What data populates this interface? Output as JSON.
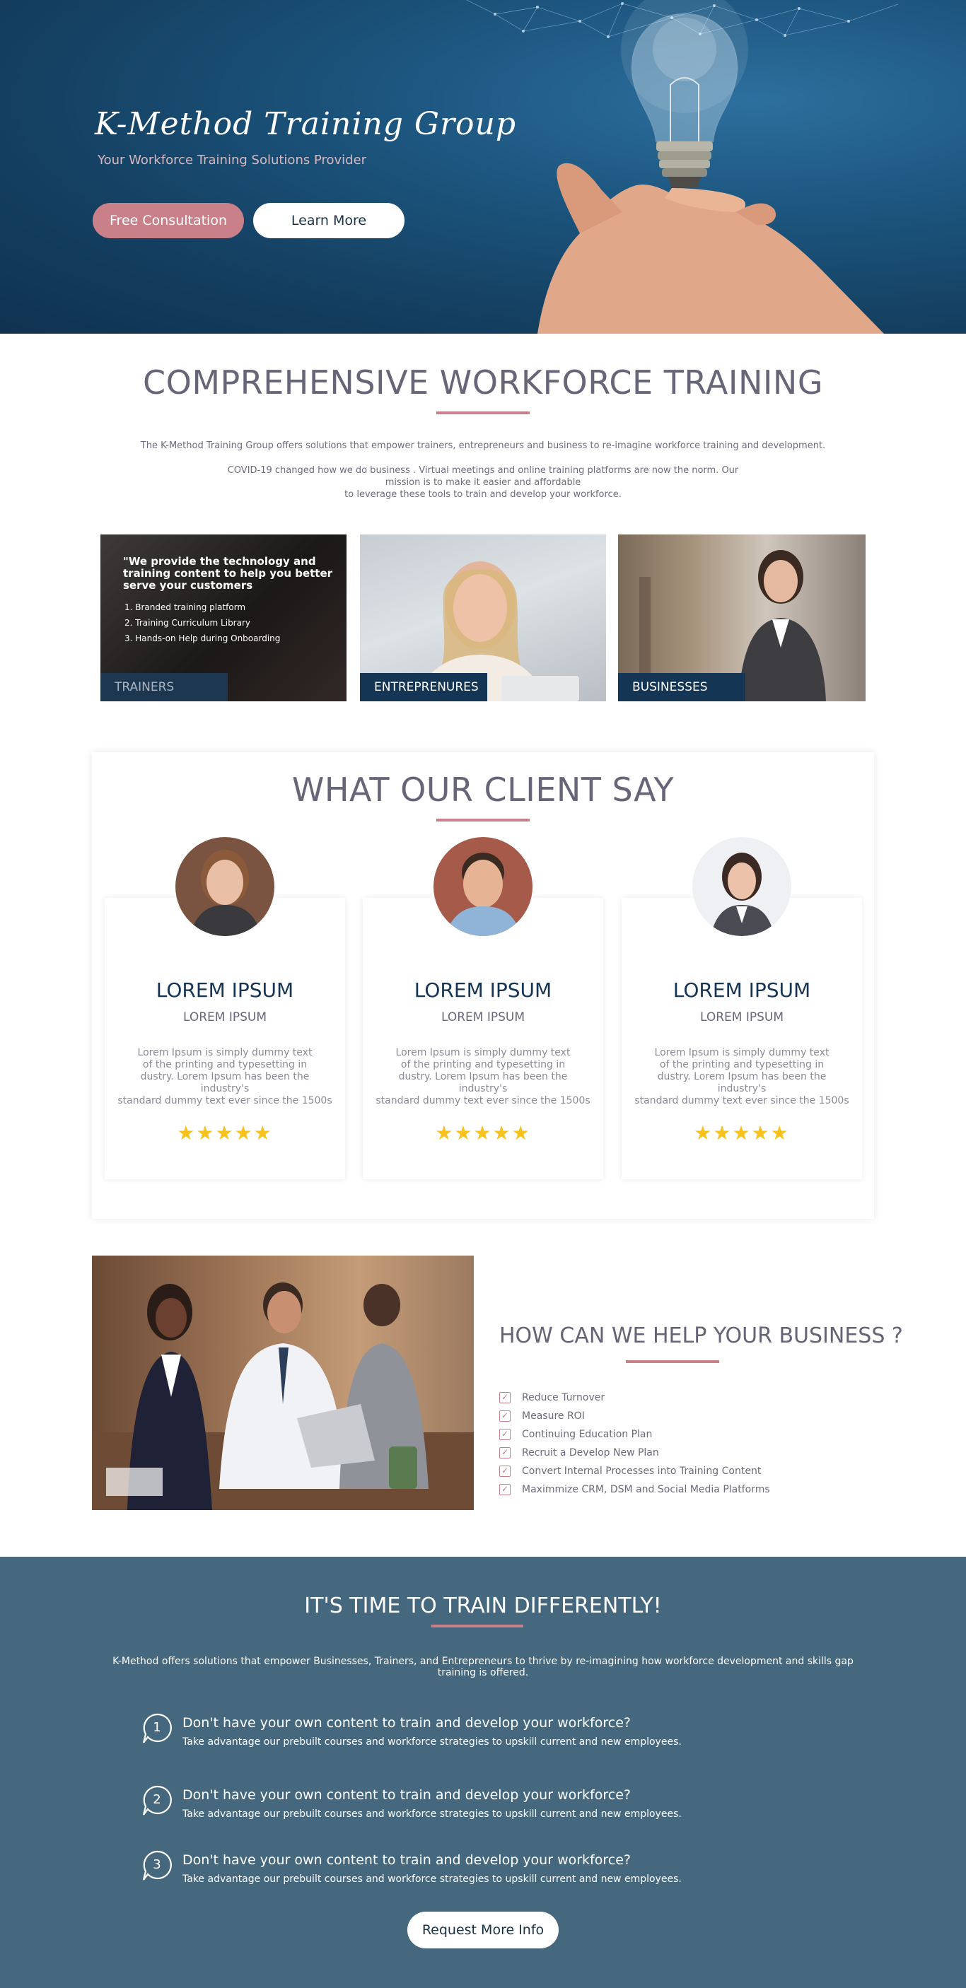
{
  "hero": {
    "title": "K-Method Training Group",
    "subtitle": "Your Workforce Training Solutions Provider",
    "consult_label": "Free Consultation",
    "learn_label": "Learn More"
  },
  "comprehensive": {
    "title": "COMPREHENSIVE WORKFORCE TRAINING",
    "para1": "The K-Method Training Group offers solutions that empower trainers, entrepreneurs and business to re-imagine workforce training and development.",
    "para2_line1": "COVID-19 changed how we do business . Virtual meetings and online training platforms are now the norm. Our mission is to make it easier and affordable",
    "para2_line2": "to leverage these tools to train and develop your workforce.",
    "cards": [
      {
        "label": "TRAINERS",
        "quote": "\"We provide the technology and training content to help you better serve your customers",
        "items": [
          "1. Branded training platform",
          "2. Training Curriculum Library",
          "3. Hands-on Help during Onboarding"
        ]
      },
      {
        "label": "ENTREPRENURES"
      },
      {
        "label": "BUSINESSES"
      }
    ]
  },
  "testimonials": {
    "title": "WHAT OUR CLIENT SAY",
    "cards": [
      {
        "name": "LOREM IPSUM",
        "role": "LOREM IPSUM",
        "line1": "Lorem Ipsum is simply dummy text",
        "line2": "of the printing and typesetting in",
        "line3": "dustry. Lorem Ipsum has been the industry's",
        "line4": "standard dummy text ever since the 1500s",
        "rating": 5,
        "stars": "★★★★★"
      },
      {
        "name": "LOREM IPSUM",
        "role": "LOREM IPSUM",
        "line1": "Lorem Ipsum is simply dummy text",
        "line2": "of the printing and typesetting in",
        "line3": "dustry. Lorem Ipsum has been the industry's",
        "line4": "standard dummy text ever since the 1500s",
        "rating": 5,
        "stars": "★★★★★"
      },
      {
        "name": "LOREM IPSUM",
        "role": "LOREM IPSUM",
        "line1": "Lorem Ipsum is simply dummy text",
        "line2": "of the printing and typesetting in",
        "line3": "dustry. Lorem Ipsum has been the industry's",
        "line4": "standard dummy text ever since the 1500s",
        "rating": 5,
        "stars": "★★★★★"
      }
    ]
  },
  "help": {
    "title": "HOW CAN WE HELP YOUR BUSINESS ?",
    "items": [
      "Reduce Turnover",
      "Measure ROI",
      "Continuing Education Plan",
      "Recruit a Develop New Plan",
      "Convert Internal Processes into Training Content",
      "Maximmize CRM, DSM and Social Media Platforms"
    ]
  },
  "train": {
    "title": "IT'S TIME TO TRAIN DIFFERENTLY!",
    "desc_line1": "K-Method offers solutions that empower Businesses, Trainers, and Entrepreneurs to thrive by re-imagining how workforce development and skills gap",
    "desc_line2": "training is offered.",
    "items": [
      {
        "num": "1",
        "q": "Don't have your own content to train and develop your workforce?",
        "a": "Take advantage our prebuilt courses and workforce strategies to upskill current and new employees."
      },
      {
        "num": "2",
        "q": "Don't have your own content to train and develop your workforce?",
        "a": "Take advantage our prebuilt courses and workforce strategies to upskill current and new employees."
      },
      {
        "num": "3",
        "q": "Don't have your own content to train and develop your workforce?",
        "a": "Take advantage our prebuilt courses and workforce strategies to upskill current and new employees."
      }
    ],
    "button_label": "Request More Info"
  },
  "colors": {
    "accent_pink": "#c98089",
    "navy": "#153554",
    "slate_blue": "#45687f",
    "star": "#f6c21b"
  },
  "icons": [
    "lightbulb-hand-image",
    "check-icon",
    "speech-bubble-icon",
    "star-icon"
  ]
}
